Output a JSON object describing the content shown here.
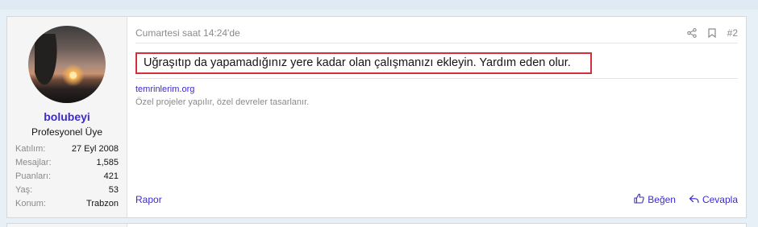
{
  "user": {
    "name": "bolubeyi",
    "title": "Profesyonel Üye",
    "stats": [
      {
        "key": "Katılım:",
        "value": "27 Eyl 2008"
      },
      {
        "key": "Mesajlar:",
        "value": "1,585"
      },
      {
        "key": "Puanları:",
        "value": "421"
      },
      {
        "key": "Yaş:",
        "value": "53"
      },
      {
        "key": "Konum:",
        "value": "Trabzon"
      }
    ]
  },
  "post": {
    "date": "Cumartesi saat 14:24'de",
    "number": "#2",
    "body": "Uğraşıtıp da yapamadığınız yere kadar olan çalışmanızı ekleyin. Yardım eden olur.",
    "highlight_color": "#d32f3d"
  },
  "signature": {
    "link": "temrinlerim.org",
    "text": "Özel projeler yapılır, özel devreler tasarlanır."
  },
  "footer": {
    "report": "Rapor",
    "like": "Beğen",
    "reply": "Cevapla"
  },
  "icons": [
    "share-icon",
    "bookmark-icon",
    "thumbs-up-icon",
    "reply-icon"
  ],
  "colors": {
    "link": "#3a2ad0",
    "muted": "#8a8a8a"
  }
}
